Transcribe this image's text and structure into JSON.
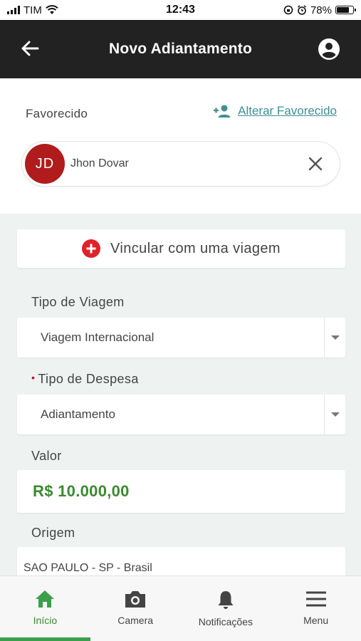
{
  "status_bar": {
    "carrier": "TIM",
    "time": "12:43",
    "battery": "78%",
    "battery_level": 0.78
  },
  "header": {
    "title": "Novo Adiantamento",
    "back_icon": "arrow-left-icon",
    "account_icon": "account-circle-icon"
  },
  "favorecido": {
    "label": "Favorecido",
    "change_link": "Alterar Favorecido",
    "selected": {
      "initials": "JD",
      "name": "Jhon Dovar"
    }
  },
  "form": {
    "vincular_button": "Vincular com uma viagem",
    "tipo_viagem": {
      "label": "Tipo de Viagem",
      "value": "Viagem Internacional"
    },
    "tipo_despesa": {
      "required_mark": "•",
      "label": "Tipo de Despesa",
      "value": "Adiantamento"
    },
    "valor": {
      "label": "Valor",
      "value": "R$ 10.000,00"
    },
    "origem": {
      "label": "Origem",
      "value": "SAO PAULO - SP - Brasil"
    }
  },
  "bottom_nav": {
    "items": [
      {
        "label": "Início",
        "icon": "home-icon",
        "active": true
      },
      {
        "label": "Camera",
        "icon": "camera-icon",
        "active": false
      },
      {
        "label": "Notificações",
        "icon": "bell-icon",
        "active": false
      },
      {
        "label": "Menu",
        "icon": "menu-icon",
        "active": false
      }
    ]
  },
  "colors": {
    "appbar": "#222222",
    "accent_green": "#3a8a2f",
    "link_teal": "#3d8f94",
    "avatar_red": "#b01c1c",
    "plus_red": "#e0232a",
    "form_background": "#eef3f1"
  }
}
